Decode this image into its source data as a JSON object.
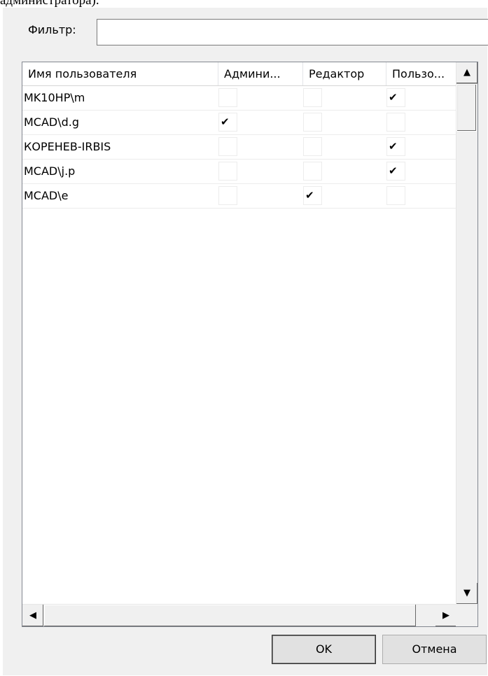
{
  "caption": "администратора).",
  "filter": {
    "label": "Фильтр:",
    "value": ""
  },
  "table": {
    "columns": [
      "Имя пользователя",
      "Админи...",
      "Редактор",
      "Пользо..."
    ],
    "rows": [
      {
        "name": "MK10HP\\m",
        "admin": false,
        "editor": false,
        "user": true
      },
      {
        "name": "MCAD\\d.g",
        "admin": true,
        "editor": false,
        "user": false
      },
      {
        "name": "КОРЕНЕВ-IRBIS",
        "admin": false,
        "editor": false,
        "user": true
      },
      {
        "name": "MCAD\\j.p",
        "admin": false,
        "editor": false,
        "user": true
      },
      {
        "name": "MCAD\\e",
        "admin": false,
        "editor": true,
        "user": false
      }
    ]
  },
  "scrollbars": {
    "up_arrow": "▲",
    "down_arrow": "▼",
    "left_arrow": "◀",
    "right_arrow": "▶"
  },
  "buttons": {
    "ok": "OK",
    "cancel": "Отмена"
  },
  "check_glyph": "✔"
}
